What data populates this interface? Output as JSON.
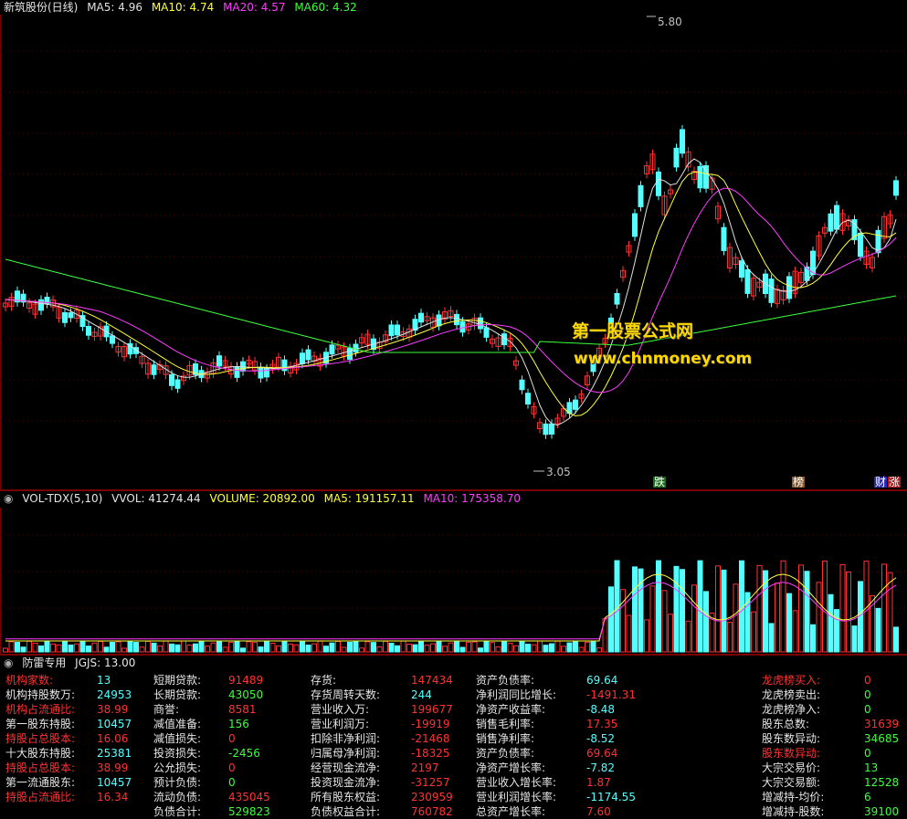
{
  "colors": {
    "up": "#ff3232",
    "down": "#54ffff",
    "ma5": "#e0e0e0",
    "ma10": "#ffff3c",
    "ma20": "#ff3cff",
    "ma60": "#3cff3c",
    "frame": "#7a0000",
    "label_red": "#ff3232",
    "label_white": "#e6e6e6",
    "value_red": "#ff3232",
    "value_green": "#3cff3c",
    "value_cyan": "#54ffff"
  },
  "main": {
    "title": "新筑股份(日线)",
    "ma": [
      {
        "label": "MA5: 4.96",
        "color": "#e0e0e0"
      },
      {
        "label": "MA10: 4.74",
        "color": "#ffff3c"
      },
      {
        "label": "MA20: 4.57",
        "color": "#ff3cff"
      },
      {
        "label": "MA60: 4.32",
        "color": "#3cff3c"
      }
    ],
    "high_label": "5.80",
    "low_label": "3.05",
    "tags": [
      {
        "text": "跌",
        "bg": "#1a6b1a",
        "fg": "#ffffff"
      },
      {
        "text": "榜",
        "bg": "#8a5a2a",
        "fg": "#ffffff"
      },
      {
        "text": "财",
        "bg": "#2a2ab0",
        "fg": "#ffffff"
      },
      {
        "text": "涨",
        "bg": "#b01a1a",
        "fg": "#ffffff"
      }
    ]
  },
  "watermark": {
    "line1": "第一股票公式网",
    "line2": "www.chnmoney.com"
  },
  "volume": {
    "title": "VOL-TDX(5,10)",
    "vvol": "VVOL: 41274.44",
    "volume": "VOLUME: 20892.00",
    "ma5": "MA5: 191157.11",
    "ma10": "MA10: 175358.70"
  },
  "indicator": {
    "title": "防雷专用",
    "jgjs": "JGJS: 13.00",
    "columns": [
      [
        {
          "label": "机构家数:",
          "value": "13",
          "lc": "label_red",
          "vc": "value_cyan"
        },
        {
          "label": "机构持股数万:",
          "value": "24953",
          "lc": "label_white",
          "vc": "value_cyan"
        },
        {
          "label": "机构占流通比:",
          "value": "38.99",
          "lc": "label_red",
          "vc": "value_red"
        },
        {
          "label": "第一股东持股:",
          "value": "10457",
          "lc": "label_white",
          "vc": "value_cyan"
        },
        {
          "label": "持股占总股本:",
          "value": "16.06",
          "lc": "label_red",
          "vc": "value_red"
        },
        {
          "label": "十大股东持股:",
          "value": "25381",
          "lc": "label_white",
          "vc": "value_cyan"
        },
        {
          "label": "持股占总股本:",
          "value": "38.99",
          "lc": "label_red",
          "vc": "value_red"
        },
        {
          "label": "第一流通股东:",
          "value": "10457",
          "lc": "label_white",
          "vc": "value_cyan"
        },
        {
          "label": "持股占流通比:",
          "value": "16.34",
          "lc": "label_red",
          "vc": "value_red"
        }
      ],
      [
        {
          "label": "短期贷款:",
          "value": "91489",
          "lc": "label_white",
          "vc": "value_red"
        },
        {
          "label": "长期贷款:",
          "value": "43050",
          "lc": "label_white",
          "vc": "value_green"
        },
        {
          "label": "商誉:",
          "value": "8581",
          "lc": "label_white",
          "vc": "value_red"
        },
        {
          "label": "减值准备:",
          "value": "156",
          "lc": "label_white",
          "vc": "value_green"
        },
        {
          "label": "减值损失:",
          "value": "0",
          "lc": "label_white",
          "vc": "value_red"
        },
        {
          "label": "投资损失:",
          "value": "-2456",
          "lc": "label_white",
          "vc": "value_green"
        },
        {
          "label": "公允损失:",
          "value": "0",
          "lc": "label_white",
          "vc": "value_red"
        },
        {
          "label": "预计负债:",
          "value": "0",
          "lc": "label_white",
          "vc": "value_green"
        },
        {
          "label": "流动负债:",
          "value": "435045",
          "lc": "label_white",
          "vc": "value_red"
        },
        {
          "label": "负债合计:",
          "value": "529823",
          "lc": "label_white",
          "vc": "value_green"
        }
      ],
      [
        {
          "label": "存货:",
          "value": "147434",
          "lc": "label_white",
          "vc": "value_red"
        },
        {
          "label": "存货周转天数:",
          "value": "244",
          "lc": "label_white",
          "vc": "value_cyan"
        },
        {
          "label": "营业收入万:",
          "value": "199677",
          "lc": "label_white",
          "vc": "value_red"
        },
        {
          "label": "营业利润万:",
          "value": "-19919",
          "lc": "label_white",
          "vc": "value_red"
        },
        {
          "label": "扣除非净利润:",
          "value": "-21468",
          "lc": "label_white",
          "vc": "value_red"
        },
        {
          "label": "归属母净利润:",
          "value": "-18325",
          "lc": "label_white",
          "vc": "value_red"
        },
        {
          "label": "经营现金流净:",
          "value": "2197",
          "lc": "label_white",
          "vc": "value_red"
        },
        {
          "label": "投资现金流净:",
          "value": "-31257",
          "lc": "label_white",
          "vc": "value_red"
        },
        {
          "label": "所有股东权益:",
          "value": "230959",
          "lc": "label_white",
          "vc": "value_red"
        },
        {
          "label": "负债权益合计:",
          "value": "760782",
          "lc": "label_white",
          "vc": "value_red"
        }
      ],
      [
        {
          "label": "资产负债率:",
          "value": "69.64",
          "lc": "label_white",
          "vc": "value_cyan"
        },
        {
          "label": "净利润同比增长:",
          "value": "-1491.31",
          "lc": "label_white",
          "vc": "value_red"
        },
        {
          "label": "净资产收益率:",
          "value": "-8.48",
          "lc": "label_white",
          "vc": "value_cyan"
        },
        {
          "label": "销售毛利率:",
          "value": "17.35",
          "lc": "label_white",
          "vc": "value_red"
        },
        {
          "label": "销售净利率:",
          "value": "-8.52",
          "lc": "label_white",
          "vc": "value_cyan"
        },
        {
          "label": "资产负债率:",
          "value": "69.64",
          "lc": "label_white",
          "vc": "value_red"
        },
        {
          "label": "净资产增长率:",
          "value": "-7.82",
          "lc": "label_white",
          "vc": "value_cyan"
        },
        {
          "label": "营业收入增长率:",
          "value": "1.87",
          "lc": "label_white",
          "vc": "value_red"
        },
        {
          "label": "营业利润增长率:",
          "value": "-1174.55",
          "lc": "label_white",
          "vc": "value_cyan"
        },
        {
          "label": "总资产增长率:",
          "value": "7.60",
          "lc": "label_white",
          "vc": "value_red"
        }
      ],
      [
        {
          "label": "龙虎榜买入:",
          "value": "0",
          "lc": "label_red",
          "vc": "value_red"
        },
        {
          "label": "龙虎榜卖出:",
          "value": "0",
          "lc": "label_white",
          "vc": "value_green"
        },
        {
          "label": "龙虎榜净入:",
          "value": "0",
          "lc": "label_white",
          "vc": "value_green"
        },
        {
          "label": "股东总数:",
          "value": "31639",
          "lc": "label_white",
          "vc": "value_red"
        },
        {
          "label": "股东数异动:",
          "value": "34685",
          "lc": "label_white",
          "vc": "value_green"
        },
        {
          "label": "股东数异动:",
          "value": "0",
          "lc": "label_red",
          "vc": "value_green"
        },
        {
          "label": "大宗交易价:",
          "value": "13",
          "lc": "label_white",
          "vc": "value_green"
        },
        {
          "label": "大宗交易额:",
          "value": "12528",
          "lc": "label_white",
          "vc": "value_green"
        },
        {
          "label": "增减持-均价:",
          "value": "6",
          "lc": "label_white",
          "vc": "value_green"
        },
        {
          "label": "增减持-股数:",
          "value": "39100",
          "lc": "label_white",
          "vc": "value_green"
        }
      ]
    ]
  }
}
